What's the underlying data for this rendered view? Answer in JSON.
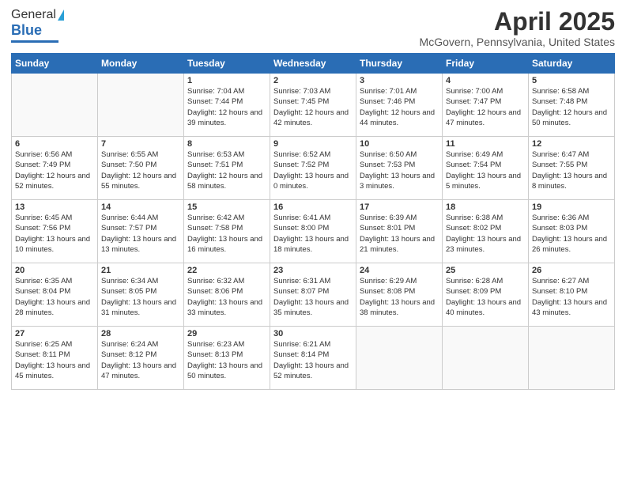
{
  "header": {
    "logo_general": "General",
    "logo_blue": "Blue",
    "title": "April 2025",
    "location": "McGovern, Pennsylvania, United States"
  },
  "weekdays": [
    "Sunday",
    "Monday",
    "Tuesday",
    "Wednesday",
    "Thursday",
    "Friday",
    "Saturday"
  ],
  "weeks": [
    [
      {
        "day": "",
        "info": ""
      },
      {
        "day": "",
        "info": ""
      },
      {
        "day": "1",
        "info": "Sunrise: 7:04 AM\nSunset: 7:44 PM\nDaylight: 12 hours and 39 minutes."
      },
      {
        "day": "2",
        "info": "Sunrise: 7:03 AM\nSunset: 7:45 PM\nDaylight: 12 hours and 42 minutes."
      },
      {
        "day": "3",
        "info": "Sunrise: 7:01 AM\nSunset: 7:46 PM\nDaylight: 12 hours and 44 minutes."
      },
      {
        "day": "4",
        "info": "Sunrise: 7:00 AM\nSunset: 7:47 PM\nDaylight: 12 hours and 47 minutes."
      },
      {
        "day": "5",
        "info": "Sunrise: 6:58 AM\nSunset: 7:48 PM\nDaylight: 12 hours and 50 minutes."
      }
    ],
    [
      {
        "day": "6",
        "info": "Sunrise: 6:56 AM\nSunset: 7:49 PM\nDaylight: 12 hours and 52 minutes."
      },
      {
        "day": "7",
        "info": "Sunrise: 6:55 AM\nSunset: 7:50 PM\nDaylight: 12 hours and 55 minutes."
      },
      {
        "day": "8",
        "info": "Sunrise: 6:53 AM\nSunset: 7:51 PM\nDaylight: 12 hours and 58 minutes."
      },
      {
        "day": "9",
        "info": "Sunrise: 6:52 AM\nSunset: 7:52 PM\nDaylight: 13 hours and 0 minutes."
      },
      {
        "day": "10",
        "info": "Sunrise: 6:50 AM\nSunset: 7:53 PM\nDaylight: 13 hours and 3 minutes."
      },
      {
        "day": "11",
        "info": "Sunrise: 6:49 AM\nSunset: 7:54 PM\nDaylight: 13 hours and 5 minutes."
      },
      {
        "day": "12",
        "info": "Sunrise: 6:47 AM\nSunset: 7:55 PM\nDaylight: 13 hours and 8 minutes."
      }
    ],
    [
      {
        "day": "13",
        "info": "Sunrise: 6:45 AM\nSunset: 7:56 PM\nDaylight: 13 hours and 10 minutes."
      },
      {
        "day": "14",
        "info": "Sunrise: 6:44 AM\nSunset: 7:57 PM\nDaylight: 13 hours and 13 minutes."
      },
      {
        "day": "15",
        "info": "Sunrise: 6:42 AM\nSunset: 7:58 PM\nDaylight: 13 hours and 16 minutes."
      },
      {
        "day": "16",
        "info": "Sunrise: 6:41 AM\nSunset: 8:00 PM\nDaylight: 13 hours and 18 minutes."
      },
      {
        "day": "17",
        "info": "Sunrise: 6:39 AM\nSunset: 8:01 PM\nDaylight: 13 hours and 21 minutes."
      },
      {
        "day": "18",
        "info": "Sunrise: 6:38 AM\nSunset: 8:02 PM\nDaylight: 13 hours and 23 minutes."
      },
      {
        "day": "19",
        "info": "Sunrise: 6:36 AM\nSunset: 8:03 PM\nDaylight: 13 hours and 26 minutes."
      }
    ],
    [
      {
        "day": "20",
        "info": "Sunrise: 6:35 AM\nSunset: 8:04 PM\nDaylight: 13 hours and 28 minutes."
      },
      {
        "day": "21",
        "info": "Sunrise: 6:34 AM\nSunset: 8:05 PM\nDaylight: 13 hours and 31 minutes."
      },
      {
        "day": "22",
        "info": "Sunrise: 6:32 AM\nSunset: 8:06 PM\nDaylight: 13 hours and 33 minutes."
      },
      {
        "day": "23",
        "info": "Sunrise: 6:31 AM\nSunset: 8:07 PM\nDaylight: 13 hours and 35 minutes."
      },
      {
        "day": "24",
        "info": "Sunrise: 6:29 AM\nSunset: 8:08 PM\nDaylight: 13 hours and 38 minutes."
      },
      {
        "day": "25",
        "info": "Sunrise: 6:28 AM\nSunset: 8:09 PM\nDaylight: 13 hours and 40 minutes."
      },
      {
        "day": "26",
        "info": "Sunrise: 6:27 AM\nSunset: 8:10 PM\nDaylight: 13 hours and 43 minutes."
      }
    ],
    [
      {
        "day": "27",
        "info": "Sunrise: 6:25 AM\nSunset: 8:11 PM\nDaylight: 13 hours and 45 minutes."
      },
      {
        "day": "28",
        "info": "Sunrise: 6:24 AM\nSunset: 8:12 PM\nDaylight: 13 hours and 47 minutes."
      },
      {
        "day": "29",
        "info": "Sunrise: 6:23 AM\nSunset: 8:13 PM\nDaylight: 13 hours and 50 minutes."
      },
      {
        "day": "30",
        "info": "Sunrise: 6:21 AM\nSunset: 8:14 PM\nDaylight: 13 hours and 52 minutes."
      },
      {
        "day": "",
        "info": ""
      },
      {
        "day": "",
        "info": ""
      },
      {
        "day": "",
        "info": ""
      }
    ]
  ]
}
